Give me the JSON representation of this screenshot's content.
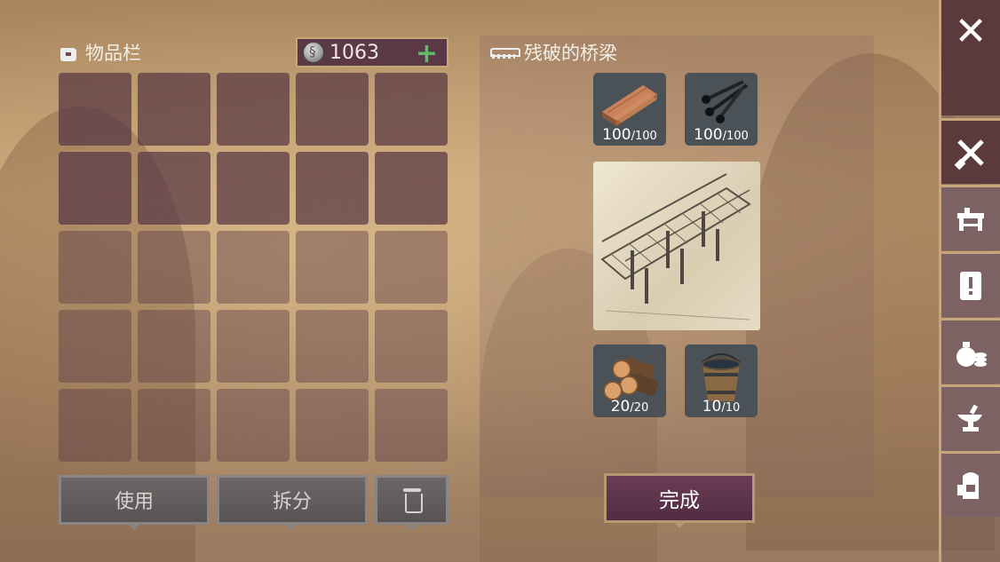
{
  "inventory": {
    "title": "物品栏",
    "currency": "1063",
    "currency_add": "+",
    "slots": 25,
    "buttons": {
      "use": "使用",
      "split": "拆分"
    }
  },
  "crafting": {
    "title": "残破的桥梁",
    "materials": [
      {
        "name": "planks-icon",
        "have": "100",
        "need": "/100"
      },
      {
        "name": "nails-icon",
        "have": "100",
        "need": "/100"
      },
      {
        "name": "logs-icon",
        "have": "20",
        "need": "/20"
      },
      {
        "name": "water-bucket-icon",
        "have": "10",
        "need": "/10"
      }
    ],
    "blueprint_icon": "bridge-blueprint-icon",
    "complete_label": "完成"
  },
  "sidebar": {
    "close": "✕",
    "tabs": [
      "crafting-tools-icon",
      "workbench-icon",
      "quest-scroll-icon",
      "money-bag-icon",
      "anvil-icon",
      "backpack-icon"
    ],
    "active_tab": "crafting-tools-icon"
  },
  "colors": {
    "slot": "#583644",
    "accent": "#c7a77a",
    "plus": "#5fbd67",
    "complete_btn": "#6a3d55"
  }
}
